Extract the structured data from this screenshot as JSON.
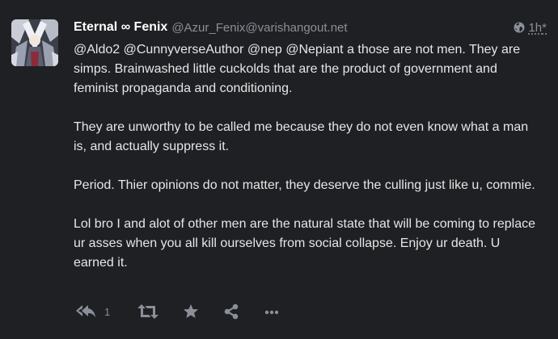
{
  "post": {
    "author": {
      "display_name": "Eternal ∞ Fenix",
      "handle": "@Azur_Fenix@varishangout.net"
    },
    "visibility_icon": "globe-icon",
    "timestamp": "1h",
    "timestamp_marker": "*",
    "mentions": [
      "@Aldo2",
      "@CunnyverseAuthor",
      "@nep",
      "@Nepiant"
    ],
    "paragraph1_tail": " a those are not men. They are simps. Brainwashed little cuckolds that are the product of government and feminist propaganda and conditioning.",
    "paragraph2": "They are unworthy to be called me because they do not even know what a man is, and actually suppress it.",
    "paragraph3": "Period. Thier opinions do not matter, they deserve the culling just like u, commie.",
    "paragraph4": "Lol bro I and alot of other men are the natural state that will be coming to replace ur asses when you all kill ourselves from social collapse. Enjoy ur death. U earned it."
  },
  "actions": {
    "reply_icon": "reply-all-icon",
    "reply_count": "1",
    "boost_icon": "retweet-icon",
    "favourite_icon": "star-icon",
    "share_icon": "share-icon",
    "more_icon": "ellipsis-icon"
  },
  "colors": {
    "background": "#1f2023",
    "text": "#e6e6e6",
    "muted": "#8a8f98"
  }
}
